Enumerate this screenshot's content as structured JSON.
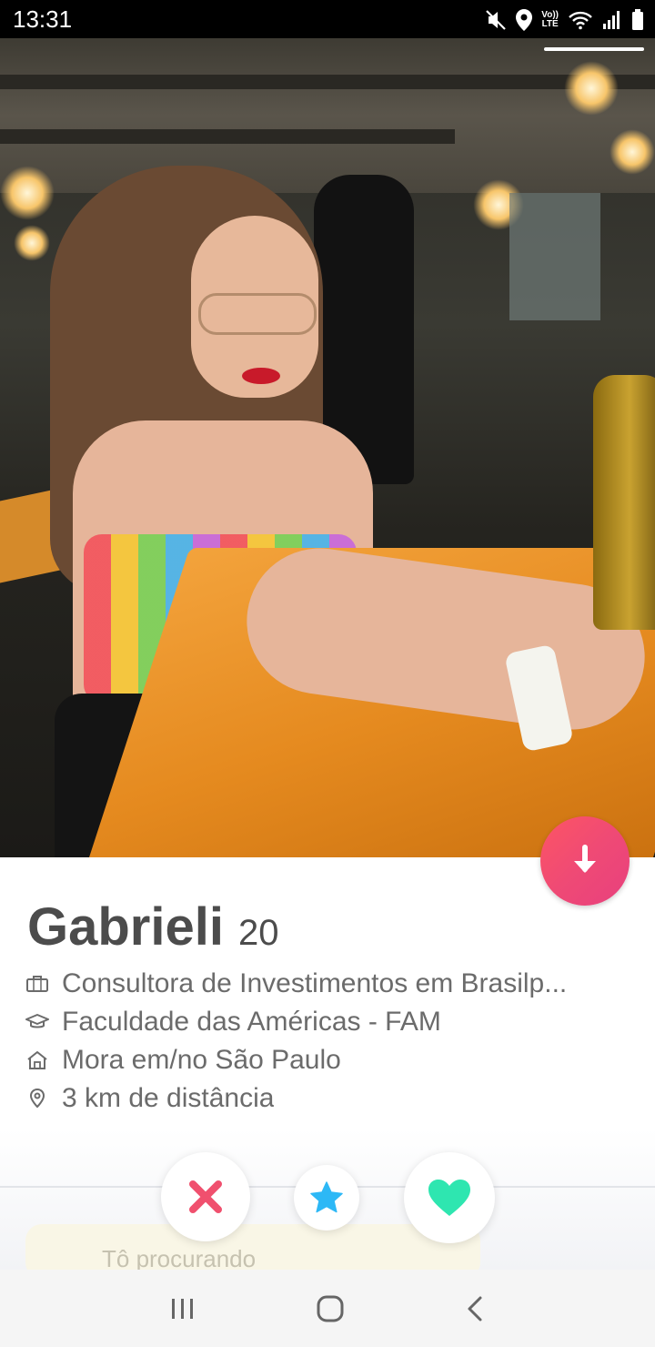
{
  "status_bar": {
    "time": "13:31",
    "volte_label_top": "Vo))",
    "volte_label_bottom": "LTE",
    "icons": [
      "mute-icon",
      "location-icon",
      "volte-icon",
      "wifi-icon",
      "signal-icon",
      "battery-icon"
    ]
  },
  "profile": {
    "name": "Gabrieli",
    "age": "20",
    "job": "Consultora de Investimentos em Brasilp...",
    "school": "Faculdade das Américas - FAM",
    "lives_in": "Mora em/no São Paulo",
    "distance": "3 km de distância",
    "looking_for_label": "Tô procurando"
  },
  "actions": {
    "info_icon": "arrow-down-icon",
    "nope_icon": "close-icon",
    "super_like_icon": "star-icon",
    "like_icon": "heart-icon"
  },
  "colors": {
    "brand_gradient_start": "#fd5564",
    "brand_gradient_end": "#e8407e",
    "nope": "#f0506e",
    "super_like": "#2db8f6",
    "like": "#2ee6b0",
    "text_primary": "#4c4c4c",
    "text_secondary": "#6b6b6b"
  },
  "nav_bar": {
    "items": [
      "recent-apps-icon",
      "home-icon",
      "back-icon"
    ]
  }
}
